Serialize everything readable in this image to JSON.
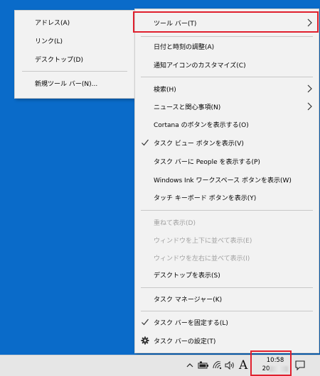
{
  "submenu": {
    "items": [
      {
        "label": "アドレス(A)"
      },
      {
        "label": "リンク(L)"
      },
      {
        "label": "デスクトップ(D)"
      },
      {
        "label": "新規ツール バー(N)..."
      }
    ]
  },
  "menu": {
    "items": [
      {
        "label": "ツール バー(T)",
        "arrow": true
      },
      {
        "label": "日付と時刻の調整(A)"
      },
      {
        "label": "通知アイコンのカスタマイズ(C)"
      },
      {
        "label": "検索(H)",
        "arrow": true
      },
      {
        "label": "ニュースと関心事項(N)",
        "arrow": true
      },
      {
        "label": "Cortana のボタンを表示する(O)"
      },
      {
        "label": "タスク ビュー ボタンを表示(V)",
        "checked": true
      },
      {
        "label": "タスク バーに People を表示する(P)"
      },
      {
        "label": "Windows Ink ワークスペース ボタンを表示(W)"
      },
      {
        "label": "タッチ キーボード ボタンを表示(Y)"
      },
      {
        "label": "重ねて表示(D)",
        "disabled": true
      },
      {
        "label": "ウィンドウを上下に並べて表示(E)",
        "disabled": true
      },
      {
        "label": "ウィンドウを左右に並べて表示(I)",
        "disabled": true
      },
      {
        "label": "デスクトップを表示(S)"
      },
      {
        "label": "タスク マネージャー(K)"
      },
      {
        "label": "タスク バーを固定する(L)",
        "checked": true
      },
      {
        "label": "タスク バーの設定(T)",
        "icon": "gear-icon"
      }
    ]
  },
  "taskbar": {
    "ime_label": "A",
    "clock_time": "10:58",
    "clock_date_prefix": "20",
    "clock_date_separators": "/ /"
  },
  "colors": {
    "desktop": "#0a6bc9",
    "menu_bg": "#f2f2f2",
    "highlight": "#e0202e",
    "disabled_text": "#a0a0a0"
  }
}
